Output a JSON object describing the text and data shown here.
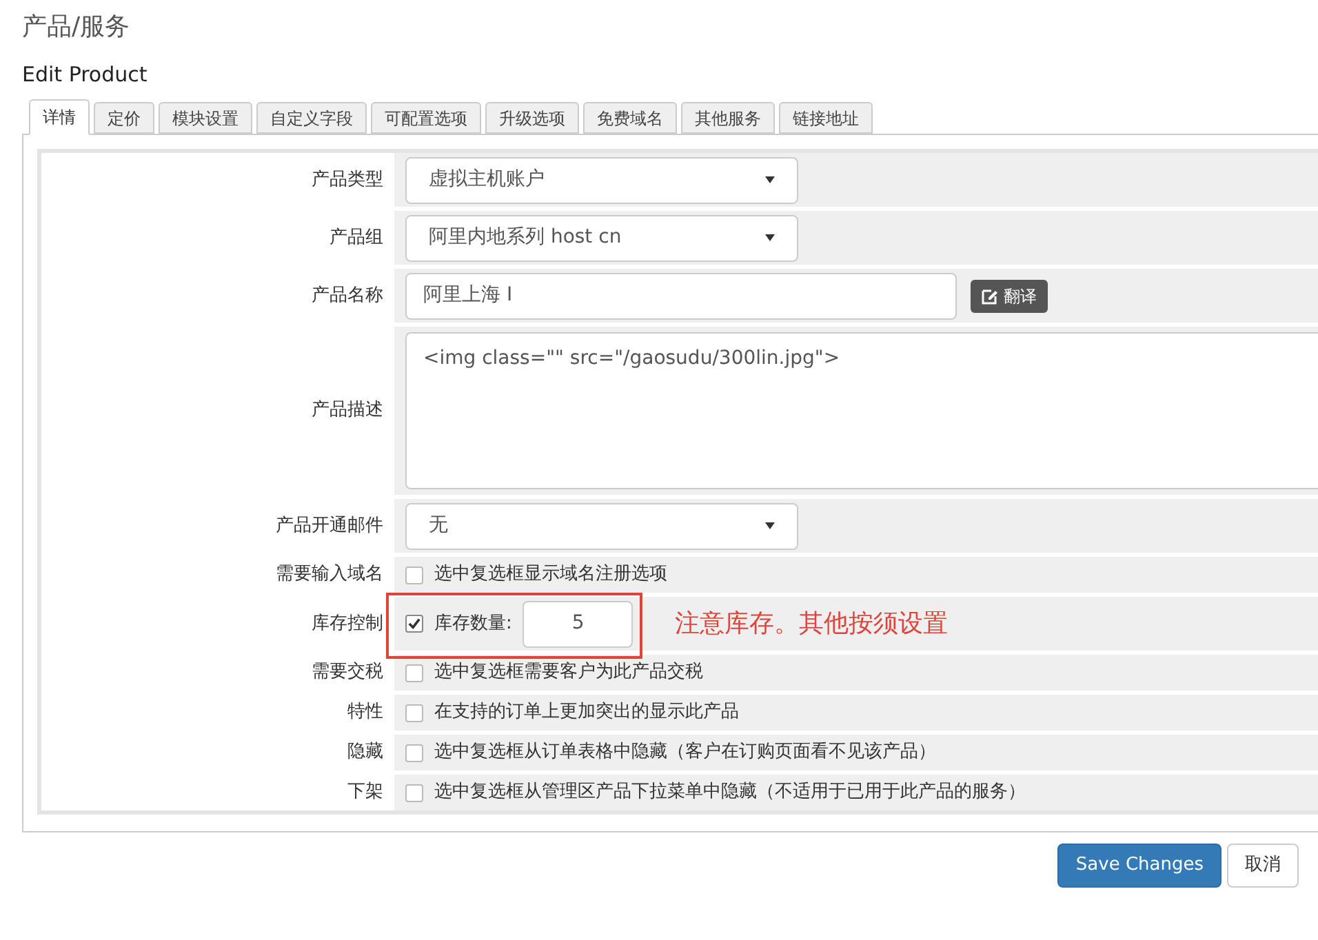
{
  "page_title": "产品/服务",
  "subtitle": "Edit Product",
  "tabs": [
    {
      "label": "详情",
      "selected": true
    },
    {
      "label": "定价",
      "selected": false
    },
    {
      "label": "模块设置",
      "selected": false
    },
    {
      "label": "自定义字段",
      "selected": false
    },
    {
      "label": "可配置选项",
      "selected": false
    },
    {
      "label": "升级选项",
      "selected": false
    },
    {
      "label": "免费域名",
      "selected": false
    },
    {
      "label": "其他服务",
      "selected": false
    },
    {
      "label": "链接地址",
      "selected": false
    }
  ],
  "fields": [
    {
      "kind": "select",
      "label": "产品类型",
      "value": "虚拟主机账户"
    },
    {
      "kind": "select",
      "label": "产品组",
      "value": "阿里内地系列 host cn"
    },
    {
      "kind": "text",
      "label": "产品名称",
      "value": "阿里上海 I",
      "button": "翻译"
    },
    {
      "kind": "textarea",
      "label": "产品描述",
      "value": "<img class=\"\" src=\"/gaosudu/300lin.jpg\">"
    },
    {
      "kind": "select",
      "label": "产品开通邮件",
      "value": "无"
    },
    {
      "kind": "checkbox",
      "label": "需要输入域名",
      "checked": false,
      "text": "选中复选框显示域名注册选项"
    },
    {
      "kind": "stock",
      "label": "库存控制",
      "checked": true,
      "text": "库存数量:",
      "value": "5",
      "note": "注意库存。其他按须设置"
    },
    {
      "kind": "checkbox",
      "label": "需要交税",
      "checked": false,
      "text": "选中复选框需要客户为此产品交税"
    },
    {
      "kind": "checkbox",
      "label": "特性",
      "checked": false,
      "text": "在支持的订单上更加突出的显示此产品"
    },
    {
      "kind": "checkbox",
      "label": "隐藏",
      "checked": false,
      "text": "选中复选框从订单表格中隐藏（客户在订购页面看不见该产品）"
    },
    {
      "kind": "checkbox",
      "label": "下架",
      "checked": false,
      "text": "选中复选框从管理区产品下拉菜单中隐藏（不适用于已用于此产品的服务）"
    }
  ],
  "buttons": [
    {
      "kind": "primary",
      "label": "Save Changes"
    },
    {
      "kind": "default",
      "label": "取消"
    }
  ]
}
